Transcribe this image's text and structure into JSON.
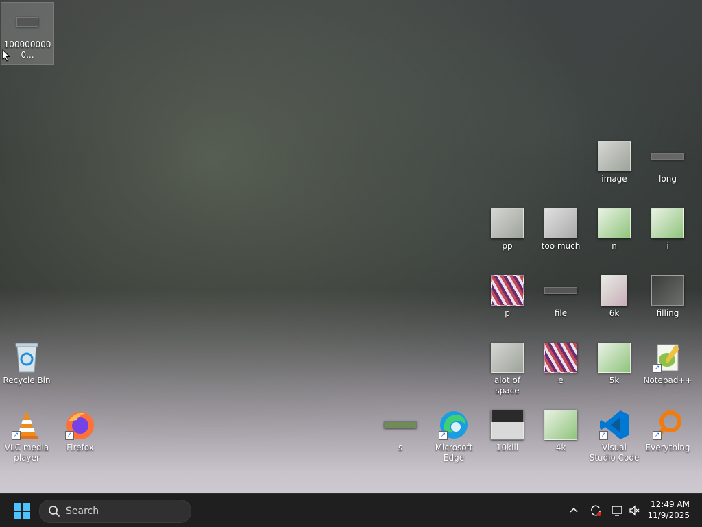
{
  "desktop": {
    "icons": [
      {
        "label": "1000000000...",
        "kind": "file"
      },
      {
        "label": "Recycle Bin",
        "kind": "recycle-bin"
      },
      {
        "label": "VLC media player",
        "kind": "app"
      },
      {
        "label": "Firefox",
        "kind": "app"
      },
      {
        "label": "s",
        "kind": "file"
      },
      {
        "label": "Microsoft Edge",
        "kind": "app"
      },
      {
        "label": "10kill",
        "kind": "file"
      },
      {
        "label": "4k",
        "kind": "file"
      },
      {
        "label": "Visual Studio Code",
        "kind": "app"
      },
      {
        "label": "Everything",
        "kind": "app"
      },
      {
        "label": "alot of space",
        "kind": "file"
      },
      {
        "label": "e",
        "kind": "file"
      },
      {
        "label": "5k",
        "kind": "file"
      },
      {
        "label": "Notepad++",
        "kind": "app"
      },
      {
        "label": "p",
        "kind": "file"
      },
      {
        "label": "file",
        "kind": "file"
      },
      {
        "label": "6k",
        "kind": "file"
      },
      {
        "label": "filling",
        "kind": "file"
      },
      {
        "label": "pp",
        "kind": "file"
      },
      {
        "label": "too much",
        "kind": "file"
      },
      {
        "label": "n",
        "kind": "file"
      },
      {
        "label": "i",
        "kind": "file"
      },
      {
        "label": "image",
        "kind": "file"
      },
      {
        "label": "long",
        "kind": "file"
      }
    ]
  },
  "taskbar": {
    "search_placeholder": "Search",
    "clock_time": "12:49 AM",
    "clock_date": "11/9/2025"
  },
  "colors": {
    "accent": "#4cc2ff",
    "taskbar_bg": "#1f1f1f"
  }
}
